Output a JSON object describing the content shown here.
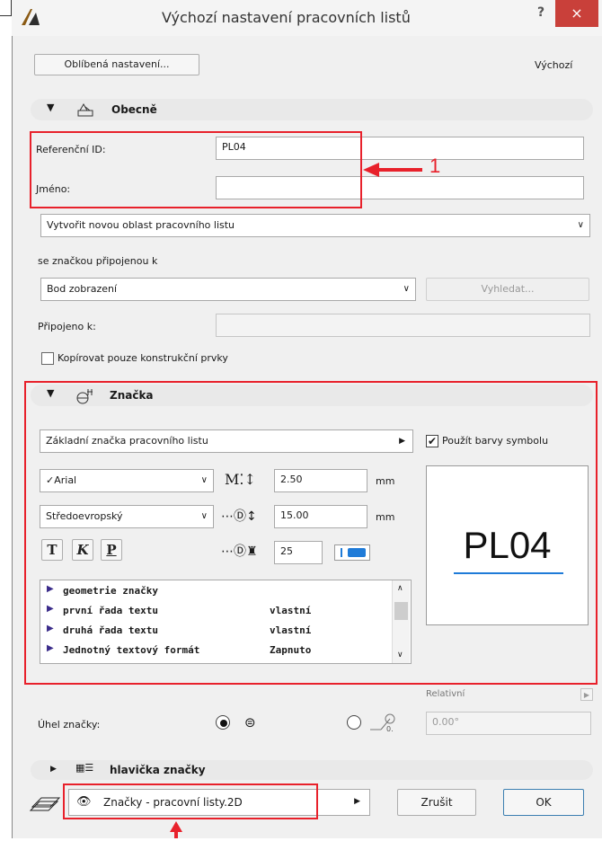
{
  "window": {
    "title": "Výchozí nastavení pracovních listů",
    "help": "?",
    "close": "×"
  },
  "top": {
    "favorites_label": "Oblíbená nastavení...",
    "default_label": "Výchozí"
  },
  "general": {
    "section_title": "Obecně",
    "ref_id_label": "Referenční ID:",
    "ref_id_value": "PL04",
    "name_label": "Jméno:",
    "name_value": "",
    "create_option": "Vytvořit novou oblast pracovního listu",
    "linked_label": "se značkou připojenou k",
    "view_point": "Bod zobrazení",
    "search_label": "Vyhledat...",
    "attached_label": "Připojeno k:",
    "copy_label": "Kopírovat pouze konstrukční prvky",
    "annotation_number": "1"
  },
  "marker": {
    "section_title": "Značka",
    "marker_type": "Základní značka pracovního listu",
    "use_symbol_colors": "Použít barvy symbolu",
    "font": "✓Arial",
    "script": "Středoevropský",
    "size_value": "2.50",
    "size_unit": "mm",
    "dim_value": "15.00",
    "dim_unit": "mm",
    "pen_value": "25",
    "preview_text": "PL04",
    "style_bold": "T",
    "style_italic": "K",
    "style_underline": "P",
    "rows": [
      {
        "name": "geometrie značky",
        "value": ""
      },
      {
        "name": "první řada textu",
        "value": "vlastní"
      },
      {
        "name": "druhá řada textu",
        "value": "vlastní"
      },
      {
        "name": "Jednotný textový formát",
        "value": "Zapnuto"
      }
    ]
  },
  "angle": {
    "relative_label": "Relativní",
    "angle_label": "Úhel značky:",
    "angle_value": "0.00°"
  },
  "header_section": {
    "title": "hlavička značky"
  },
  "bottom": {
    "layer_label": "Značky - pracovní listy.2D",
    "cancel_label": "Zrušit",
    "ok_label": "OK"
  },
  "colors": {
    "annotation_red": "#e8212b",
    "accent_blue": "#1f7bd8"
  }
}
